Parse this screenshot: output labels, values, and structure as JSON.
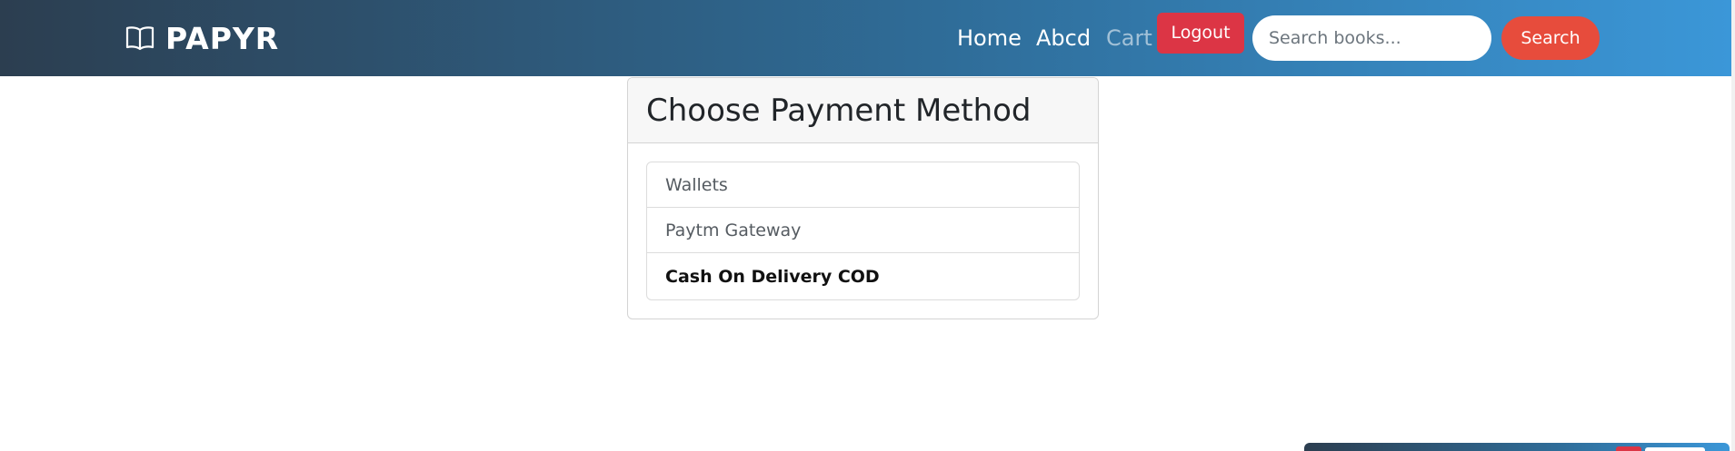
{
  "header": {
    "brand_name": "PAPYR",
    "brand_icon": "book-open-icon",
    "nav": [
      {
        "label": "Home"
      },
      {
        "label": "Abcd"
      },
      {
        "label": "Cart",
        "state": "muted"
      }
    ],
    "logout_label": "Logout",
    "search": {
      "placeholder": "Search books...",
      "value": "",
      "button_label": "Search"
    }
  },
  "payment": {
    "title": "Choose Payment Method",
    "methods": [
      {
        "label": "Wallets",
        "selected": false
      },
      {
        "label": "Paytm Gateway",
        "selected": false
      },
      {
        "label": "Cash On Delivery COD",
        "selected": true
      }
    ]
  },
  "colors": {
    "navbar_gradient_start": "#2c3e50",
    "navbar_gradient_end": "#3b97d8",
    "logout_bg": "#dc3545",
    "search_button_bg": "#e74c3c"
  }
}
